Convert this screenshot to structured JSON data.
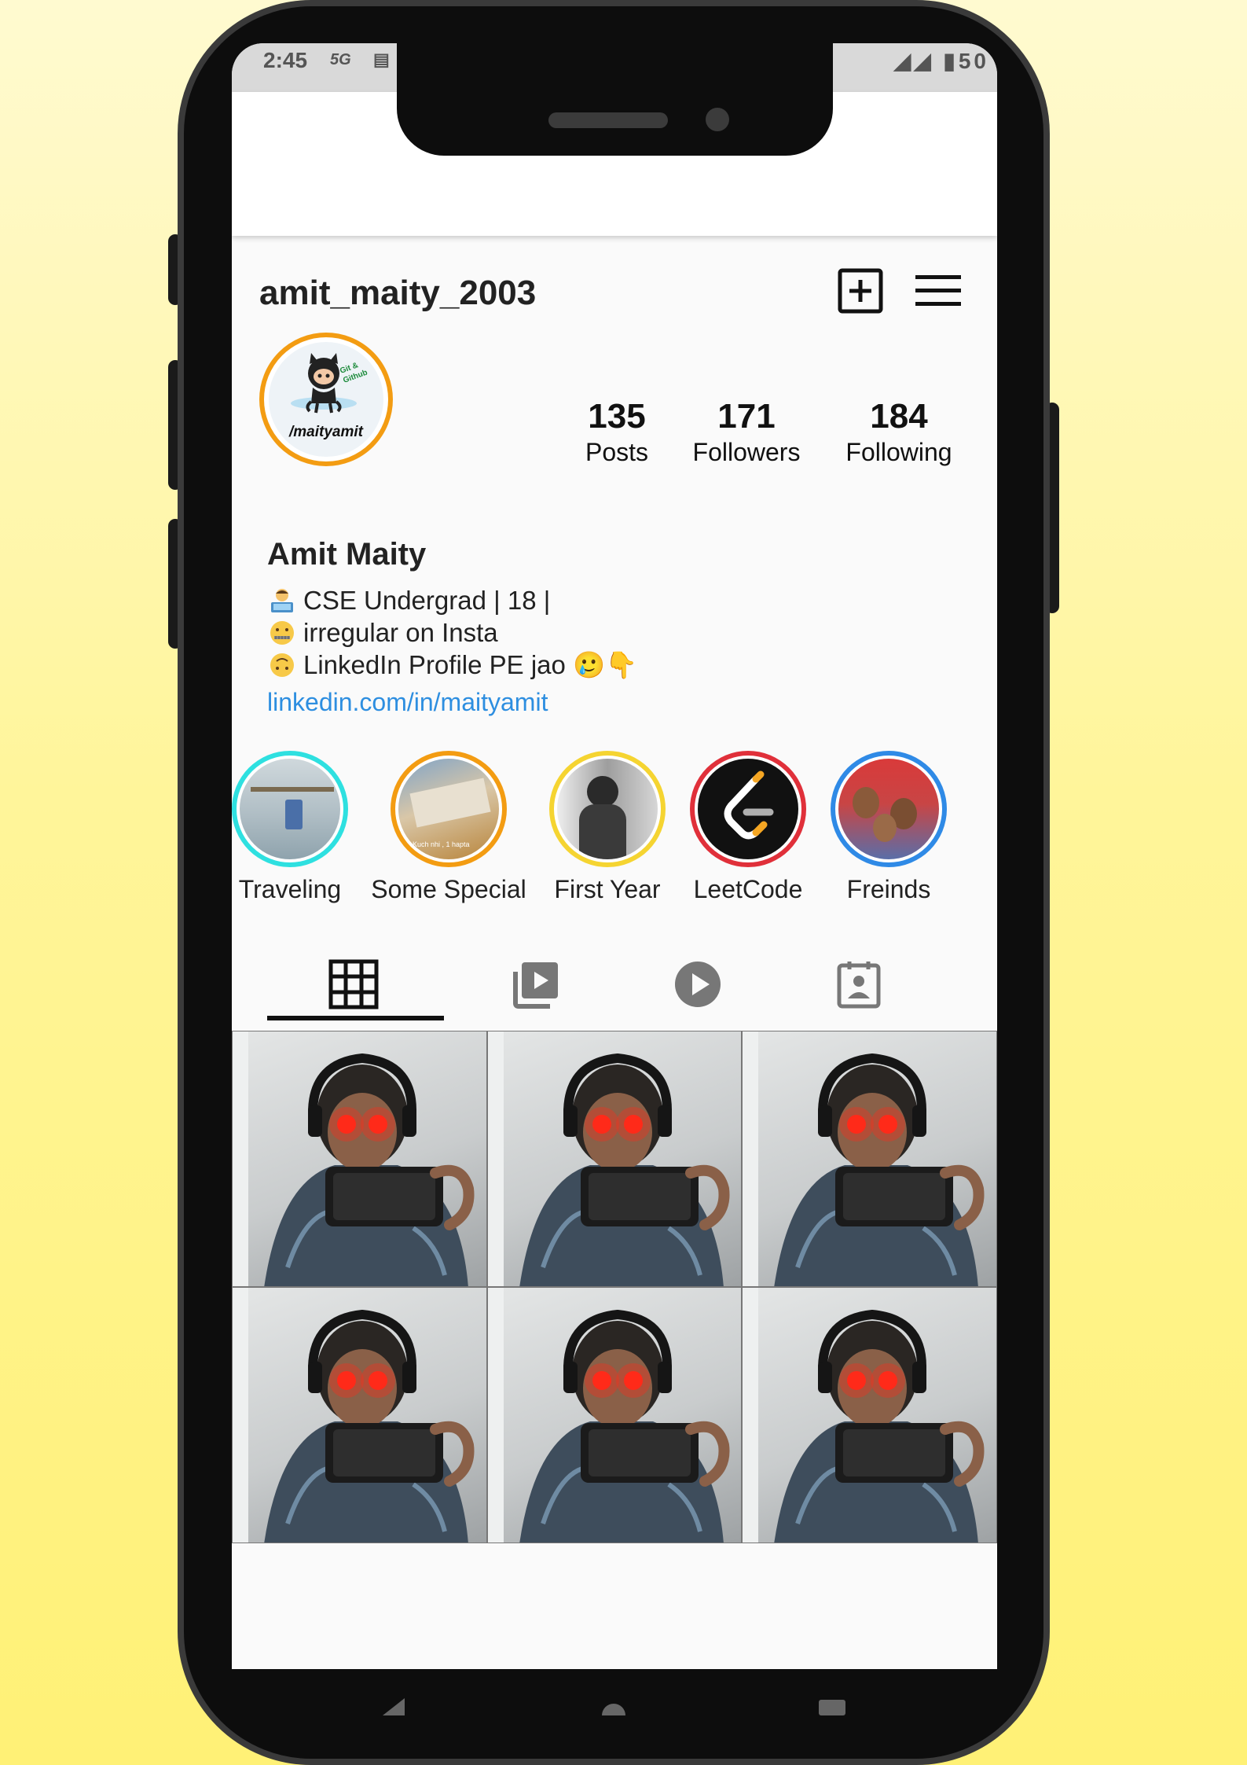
{
  "status_bar": {
    "time": "2:45",
    "network": "5G",
    "battery": "50"
  },
  "profile": {
    "username": "amit_maity_2003",
    "avatar_handle": "/maityamit",
    "full_name": "Amit Maity",
    "stats": [
      {
        "count": "135",
        "label": "Posts"
      },
      {
        "count": "171",
        "label": "Followers"
      },
      {
        "count": "184",
        "label": "Following"
      }
    ],
    "bio": [
      {
        "emoji": "technologist",
        "text": "CSE Undergrad | 18 |"
      },
      {
        "emoji": "zipper-mouth",
        "text": "irregular on Insta"
      },
      {
        "emoji": "upside-down-face",
        "text": "LinkedIn Profile PE jao 🥲👇"
      }
    ],
    "link": "linkedin.com/in/maityamit"
  },
  "highlights": [
    {
      "label": "Traveling",
      "ring_color": "#2ee0e0"
    },
    {
      "label": "Some Special",
      "ring_color": "#f39c12",
      "caption": "Kuch nhi , 1 hapta"
    },
    {
      "label": "First Year",
      "ring_color": "#f5d431"
    },
    {
      "label": "LeetCode",
      "ring_color": "#e0303a"
    },
    {
      "label": "Freinds",
      "ring_color": "#2f8ae6"
    }
  ],
  "tabs": [
    {
      "name": "posts-grid",
      "active": true
    },
    {
      "name": "reels",
      "active": false
    },
    {
      "name": "videos",
      "active": false
    },
    {
      "name": "tagged",
      "active": false
    }
  ],
  "posts_count_shown": 6,
  "colors": {
    "avatar_ring": "#f39c12",
    "link": "#2d8ee0",
    "background_top": "#fffad0",
    "background_bottom": "#fff176"
  }
}
